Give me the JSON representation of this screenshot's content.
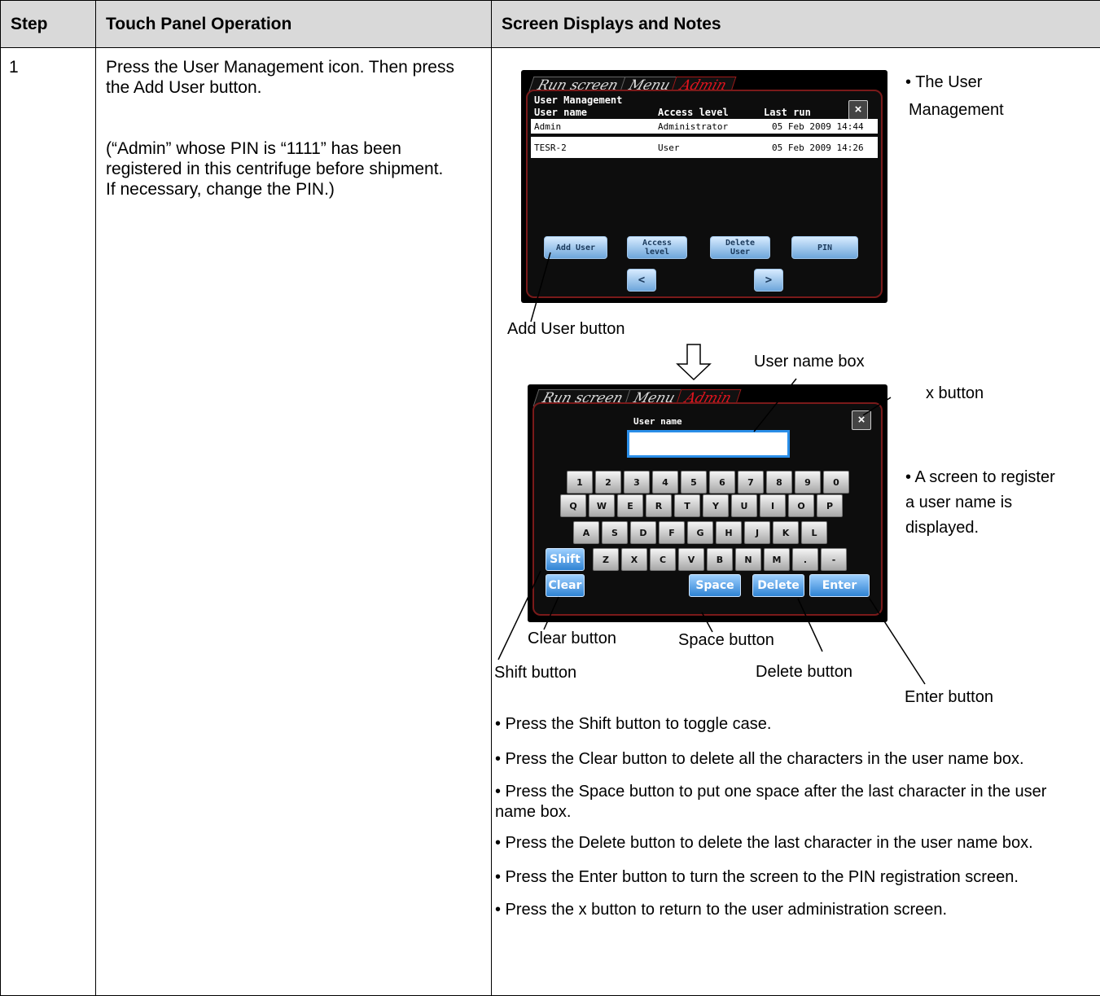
{
  "headers": {
    "step": "Step",
    "operation": "Touch Panel Operation",
    "notes": "Screen Displays and Notes"
  },
  "step_number": "1",
  "operation_text": {
    "line1": "Press the User Management icon. Then press",
    "line2": "the Add User button.",
    "note1": "(“Admin” whose PIN is “1111” has been",
    "note2": "registered in this centrifuge before shipment.",
    "note3": "If necessary, change the PIN.)"
  },
  "screen1": {
    "tabs": [
      "Run screen",
      "Menu",
      "Admin"
    ],
    "title": "User Management",
    "close": "×",
    "columns": [
      "User name",
      "Access level",
      "Last run"
    ],
    "rows": [
      {
        "name": "Admin",
        "level": "Administrator",
        "last": "05 Feb 2009 14:44"
      },
      {
        "name": "TESR-2",
        "level": "User",
        "last": "05 Feb 2009 14:26"
      }
    ],
    "buttons": {
      "add_user": "Add User",
      "access_1": "Access",
      "access_2": "level",
      "delete_1": "Delete",
      "delete_2": "User",
      "pin": "PIN",
      "prev": "<",
      "next": ">"
    },
    "note_1": "• The User",
    "note_2": "Management"
  },
  "screen2": {
    "tabs": [
      "Run screen",
      "Menu",
      "Admin"
    ],
    "label": "User name",
    "close": "×",
    "keys_row1": [
      "1",
      "2",
      "3",
      "4",
      "5",
      "6",
      "7",
      "8",
      "9",
      "0"
    ],
    "keys_row2": [
      "Q",
      "W",
      "E",
      "R",
      "T",
      "Y",
      "U",
      "I",
      "O",
      "P"
    ],
    "keys_row3": [
      "A",
      "S",
      "D",
      "F",
      "G",
      "H",
      "J",
      "K",
      "L"
    ],
    "keys_row4": [
      "Z",
      "X",
      "C",
      "V",
      "B",
      "N",
      "M",
      ".",
      "-"
    ],
    "shift": "Shift",
    "clear": "Clear",
    "space": "Space",
    "delete": "Delete",
    "enter": "Enter",
    "note_1": "• A screen to register",
    "note_2": "a user name is",
    "note_3": "displayed."
  },
  "annotations": {
    "add_user_button": "Add User button",
    "user_name_box": "User name box",
    "x_button": "x button",
    "clear_button": "Clear button",
    "space_button": "Space button",
    "shift_button": "Shift button",
    "delete_button": "Delete button",
    "enter_button": "Enter button"
  },
  "bullets": [
    "• Press the Shift button to toggle case.",
    "• Press the Clear button to delete all the characters in the user name box.",
    "• Press the Space button to put one space after the last character in the user name box.",
    "• Press the Delete button to delete the last character in the user name box.",
    "• Press the Enter button to turn the screen to the PIN registration screen.",
    "• Press the x button to return to the user administration screen."
  ]
}
